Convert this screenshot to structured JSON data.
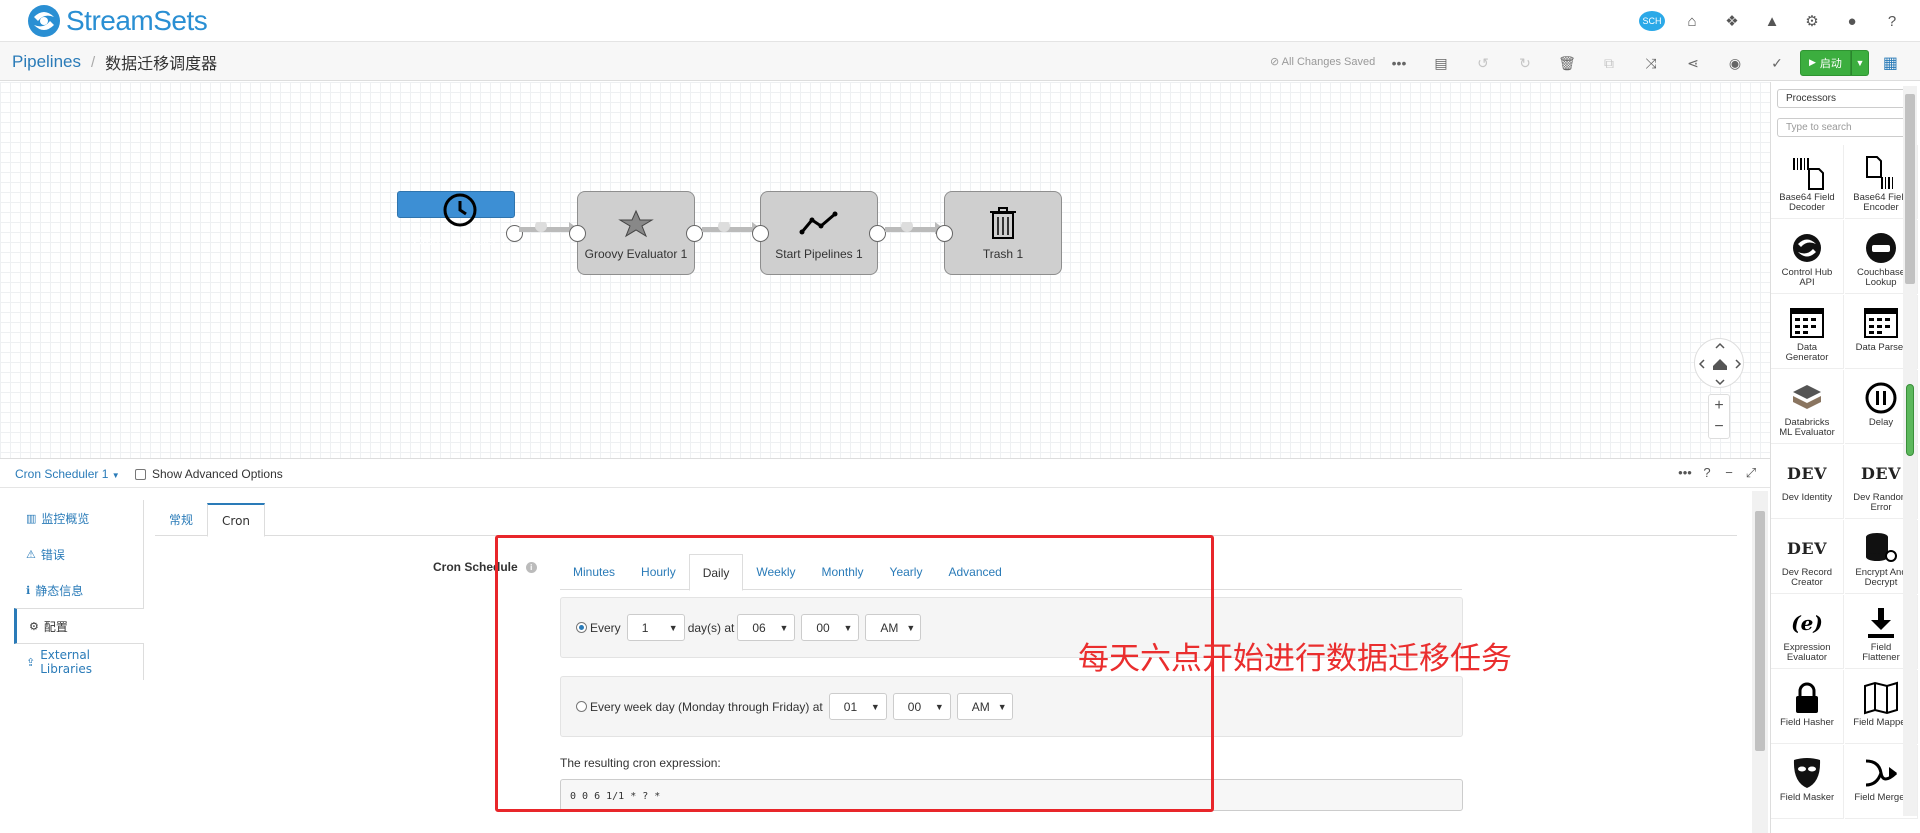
{
  "app": {
    "logo_text": "StreamSets"
  },
  "topbar": {
    "sch_badge": "SCH"
  },
  "breadcrumb": {
    "root": "Pipelines",
    "separator": "/",
    "current": "数据迁移调度器"
  },
  "toolbar": {
    "save_status": "All Changes Saved",
    "start_label": "启动"
  },
  "pipeline": {
    "stages": [
      {
        "label": "Cron Scheduler 1",
        "icon": "clock-icon",
        "selected": true
      },
      {
        "label": "Groovy Evaluator 1",
        "icon": "groovy-star-icon",
        "selected": false
      },
      {
        "label": "Start Pipelines 1",
        "icon": "line-chart-icon",
        "selected": false
      },
      {
        "label": "Trash 1",
        "icon": "trash-icon",
        "selected": false
      }
    ]
  },
  "library": {
    "category": "Processors",
    "search_placeholder": "Type to search",
    "items": [
      {
        "label": "Base64 Field\nDecoder",
        "icon": "barcode-doc-icon"
      },
      {
        "label": "Base64 Field\nEncoder",
        "icon": "doc-barcode-icon"
      },
      {
        "label": "Control Hub\nAPI",
        "icon": "streamsets-logo-icon"
      },
      {
        "label": "Couchbase\nLookup",
        "icon": "couchbase-icon"
      },
      {
        "label": "Data\nGenerator",
        "icon": "data-grid-icon"
      },
      {
        "label": "Data Parser",
        "icon": "data-grid-icon"
      },
      {
        "label": "Databricks\nML Evaluator",
        "icon": "databricks-icon"
      },
      {
        "label": "Delay",
        "icon": "pause-icon"
      },
      {
        "label": "Dev Identity",
        "icon": "dev-text-icon"
      },
      {
        "label": "Dev Random\nError",
        "icon": "dev-text-icon"
      },
      {
        "label": "Dev Record\nCreator",
        "icon": "dev-text-icon"
      },
      {
        "label": "Encrypt And\nDecrypt",
        "icon": "database-key-icon"
      },
      {
        "label": "Expression\nEvaluator",
        "icon": "expression-icon"
      },
      {
        "label": "Field\nFlattener",
        "icon": "download-icon"
      },
      {
        "label": "Field Hasher",
        "icon": "lock-icon"
      },
      {
        "label": "Field Mapper",
        "icon": "map-icon"
      },
      {
        "label": "Field Masker",
        "icon": "mask-icon"
      },
      {
        "label": "Field Merger",
        "icon": "merge-icon"
      }
    ]
  },
  "config": {
    "stage_title": "Cron Scheduler 1",
    "show_advanced": "Show Advanced Options",
    "side_nav": [
      {
        "label": "监控概览",
        "icon": "bar-chart-icon"
      },
      {
        "label": "错误",
        "icon": "warning-icon"
      },
      {
        "label": "静态信息",
        "icon": "info-icon"
      },
      {
        "label": "配置",
        "icon": "gear-icon"
      },
      {
        "label": "External Libraries",
        "icon": "upload-icon"
      }
    ],
    "tabs": [
      "常规",
      "Cron"
    ],
    "cron_label": "Cron Schedule",
    "cron_tabs": [
      "Minutes",
      "Hourly",
      "Daily",
      "Weekly",
      "Monthly",
      "Yearly",
      "Advanced"
    ],
    "option_every": {
      "label": "Every",
      "days": "1",
      "unit": "day(s) at",
      "hour": "06",
      "minute": "00",
      "ampm": "AM"
    },
    "option_weekday": {
      "label": "Every week day (Monday through Friday) at",
      "hour": "01",
      "minute": "00",
      "ampm": "AM"
    },
    "result_label": "The resulting cron expression:",
    "result_value": "0 0 6 1/1 * ? *"
  },
  "annotation": {
    "text": "每天六点开始进行数据迁移任务",
    "color": "#e8262a"
  }
}
